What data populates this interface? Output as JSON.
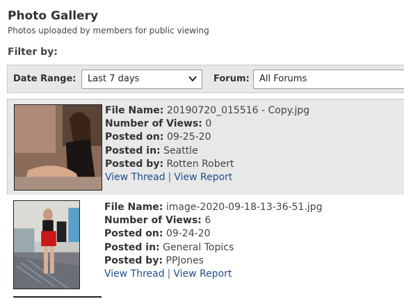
{
  "header": {
    "title": "Photo Gallery",
    "subtitle": "Photos uploaded by members for public viewing"
  },
  "filters": {
    "heading": "Filter by:",
    "date_range_label": "Date Range:",
    "date_range_value": "Last 7 days",
    "forum_label": "Forum:",
    "forum_value": "All Forums"
  },
  "field_labels": {
    "file_name": "File Name:",
    "views": "Number of Views:",
    "posted_on": "Posted on:",
    "posted_in": "Posted in:",
    "posted_by": "Posted by:"
  },
  "actions": {
    "view_thread": "View Thread",
    "separator": "|",
    "view_report": "View Report"
  },
  "items": [
    {
      "file_name": "20190720_015516 - Copy.jpg",
      "views": "0",
      "posted_on": "09-25-20",
      "posted_in": "Seattle",
      "posted_by": "Rotten Robert"
    },
    {
      "file_name": "image-2020-09-18-13-36-51.jpg",
      "views": "6",
      "posted_on": "09-24-20",
      "posted_in": "General Topics",
      "posted_by": "PPJones"
    }
  ],
  "colors": {
    "link": "#1f4e8c",
    "row_shade": "#e8e8e8"
  }
}
